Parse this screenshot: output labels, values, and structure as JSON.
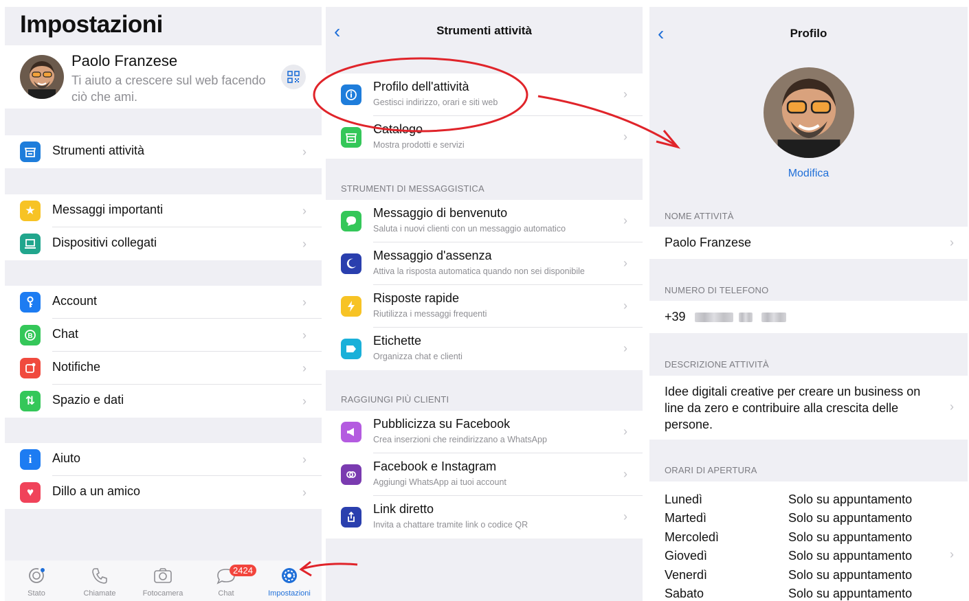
{
  "settings": {
    "title": "Impostazioni",
    "profile": {
      "name": "Paolo Franzese",
      "status": "Ti aiuto a crescere sul web facendo ciò che ami."
    },
    "groups": [
      [
        {
          "label": "Strumenti attività",
          "icon": "storefront-icon",
          "color": "#1e7ddb"
        }
      ],
      [
        {
          "label": "Messaggi importanti",
          "icon": "star-icon",
          "color": "#f7c325"
        },
        {
          "label": "Dispositivi collegati",
          "icon": "laptop-icon",
          "color": "#21a68d"
        }
      ],
      [
        {
          "label": "Account",
          "icon": "key-icon",
          "color": "#1d7cf2"
        },
        {
          "label": "Chat",
          "icon": "chat-icon",
          "color": "#34c759"
        },
        {
          "label": "Notifiche",
          "icon": "notification-icon",
          "color": "#f04a3e"
        },
        {
          "label": "Spazio e dati",
          "icon": "arrows-icon",
          "color": "#34c759"
        }
      ],
      [
        {
          "label": "Aiuto",
          "icon": "info-icon",
          "color": "#1d7cf2"
        },
        {
          "label": "Dillo a un amico",
          "icon": "heart-icon",
          "color": "#f0435a"
        }
      ]
    ],
    "tabs": [
      {
        "label": "Stato",
        "icon": "status-icon"
      },
      {
        "label": "Chiamate",
        "icon": "phone-icon"
      },
      {
        "label": "Fotocamera",
        "icon": "camera-icon"
      },
      {
        "label": "Chat",
        "icon": "chat-bubble-icon",
        "badge": "2424"
      },
      {
        "label": "Impostazioni",
        "icon": "settings-gear-icon",
        "active": true
      }
    ]
  },
  "business_tools": {
    "title": "Strumenti attività",
    "top": [
      {
        "title": "Profilo dell'attività",
        "subtitle": "Gestisci indirizzo, orari e siti web",
        "icon": "storefront-info-icon",
        "color": "#1e7ddb"
      },
      {
        "title": "Catalogo",
        "subtitle": "Mostra prodotti e servizi",
        "icon": "shop-icon",
        "color": "#34c759"
      }
    ],
    "messaging_header": "STRUMENTI DI MESSAGGISTICA",
    "messaging": [
      {
        "title": "Messaggio di benvenuto",
        "subtitle": "Saluta i nuovi clienti con un messaggio automatico",
        "icon": "welcome-bubble-icon",
        "color": "#34c759"
      },
      {
        "title": "Messaggio d'assenza",
        "subtitle": "Attiva la risposta automatica quando non sei disponibile",
        "icon": "moon-icon",
        "color": "#2a3fae"
      },
      {
        "title": "Risposte rapide",
        "subtitle": "Riutilizza i messaggi frequenti",
        "icon": "lightning-icon",
        "color": "#f7c325"
      },
      {
        "title": "Etichette",
        "subtitle": "Organizza chat e clienti",
        "icon": "label-icon",
        "color": "#1ab0d9"
      }
    ],
    "reach_header": "RAGGIUNGI PIÙ CLIENTI",
    "reach": [
      {
        "title": "Pubblicizza su Facebook",
        "subtitle": "Crea inserzioni che reindirizzano a WhatsApp",
        "icon": "megaphone-icon",
        "color": "#b45be0"
      },
      {
        "title": "Facebook e Instagram",
        "subtitle": "Aggiungi WhatsApp ai tuoi account",
        "icon": "link-accounts-icon",
        "color": "#7a3bb0"
      },
      {
        "title": "Link diretto",
        "subtitle": "Invita a chattare tramite link o codice QR",
        "icon": "share-icon",
        "color": "#2a3fae"
      }
    ]
  },
  "profile": {
    "title": "Profilo",
    "edit": "Modifica",
    "name_header": "NOME ATTIVITÀ",
    "name": "Paolo Franzese",
    "phone_header": "NUMERO DI TELEFONO",
    "phone_prefix": "+39",
    "description_header": "DESCRIZIONE ATTIVITÀ",
    "description": "Idee digitali creative per creare un business on line da zero e contribuire alla crescita delle persone.",
    "hours_header": "ORARI DI APERTURA",
    "hours": [
      {
        "day": "Lunedì",
        "value": "Solo su appuntamento"
      },
      {
        "day": "Martedì",
        "value": "Solo su appuntamento"
      },
      {
        "day": "Mercoledì",
        "value": "Solo su appuntamento"
      },
      {
        "day": "Giovedì",
        "value": "Solo su appuntamento"
      },
      {
        "day": "Venerdì",
        "value": "Solo su appuntamento"
      },
      {
        "day": "Sabato",
        "value": "Solo su appuntamento"
      }
    ]
  },
  "colors": {
    "accent": "#1f6fd8",
    "annotation": "#e0242a"
  }
}
